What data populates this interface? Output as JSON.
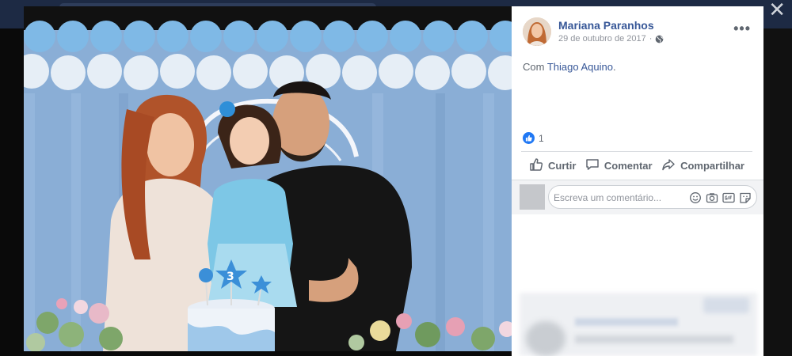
{
  "post": {
    "author": "Mariana Paranhos",
    "date": "29 de outubro de 2017",
    "date_separator": "·",
    "privacy_icon": "globe-icon",
    "more_label": "•••",
    "caption_prefix": "Com ",
    "caption_tag": "Thiago Aquino",
    "caption_suffix": "."
  },
  "reactions": {
    "icon": "like-icon",
    "count": "1"
  },
  "actions": [
    {
      "label": "Curtir",
      "icon": "thumbs-up-icon"
    },
    {
      "label": "Comentar",
      "icon": "comment-bubble-icon"
    },
    {
      "label": "Compartilhar",
      "icon": "share-arrow-icon"
    }
  ],
  "comment": {
    "placeholder": "Escreva um comentário...",
    "icons": [
      "emoji-icon",
      "camera-icon",
      "gif-icon",
      "sticker-icon"
    ]
  },
  "viewer": {
    "close_label": "✕"
  },
  "colors": {
    "link_blue": "#385898",
    "like_blue": "#2078f4",
    "muted_text": "#606770"
  }
}
